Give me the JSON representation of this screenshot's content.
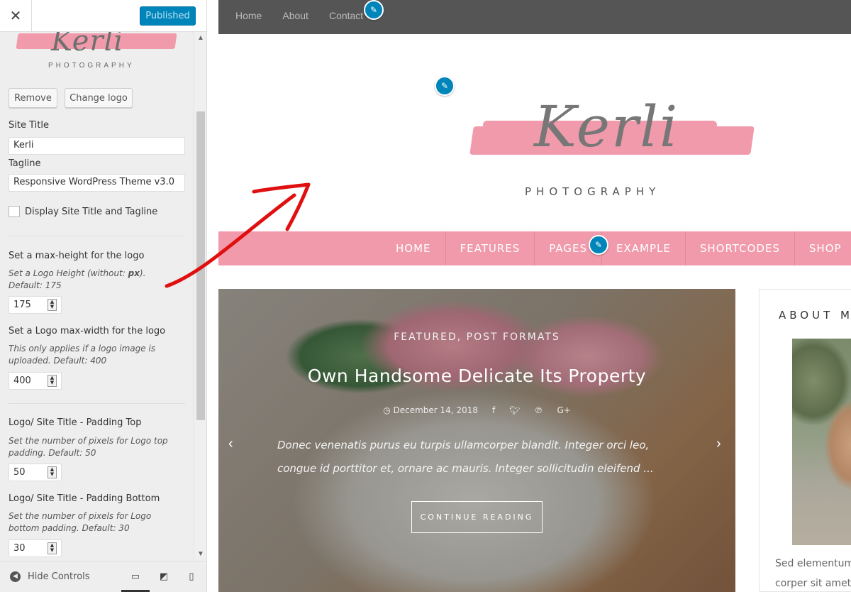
{
  "sidebar": {
    "close_glyph": "✕",
    "publish_label": "Published",
    "logo_preview": {
      "script_text": "Kerli",
      "sub_text": "PHOTOGRAPHY"
    },
    "buttons": {
      "remove": "Remove",
      "change_logo": "Change logo"
    },
    "site_title_label": "Site Title",
    "site_title_value": "Kerli",
    "tagline_label": "Tagline",
    "tagline_value": "Responsive WordPress Theme v3.0",
    "display_title_label": "Display Site Title and Tagline",
    "max_height": {
      "label": "Set a max-height for the logo",
      "desc_1": "Set a Logo Height (without: ",
      "desc_bold": "px",
      "desc_2": "). Default: 175",
      "value": "175"
    },
    "max_width": {
      "label": "Set a Logo max-width for the logo",
      "desc": "This only applies if a logo image is uploaded. Default: 400",
      "value": "400"
    },
    "padding_top": {
      "label": "Logo/ Site Title - Padding Top",
      "desc": "Set the number of pixels for Logo top padding. Default: 50",
      "value": "50"
    },
    "padding_bottom": {
      "label": "Logo/ Site Title - Padding Bottom",
      "desc": "Set the number of pixels for Logo bottom padding. Default: 30",
      "value": "30"
    },
    "footer": {
      "hide_controls": "Hide Controls",
      "active_device": "desktop"
    }
  },
  "preview": {
    "topbar_links": [
      "Home",
      "About",
      "Contact"
    ],
    "logo": {
      "script_text": "Kerli",
      "sub_text": "PHOTOGRAPHY"
    },
    "nav": [
      "HOME",
      "FEATURES",
      "PAGES",
      "EXAMPLE",
      "SHORTCODES",
      "SHOP"
    ],
    "slide": {
      "categories": "FEATURED, POST FORMATS",
      "title": "Own Handsome Delicate Its Property",
      "date": "December 14, 2018",
      "excerpt": "Donec venenatis purus eu turpis ullamcorper blandit. Integer orci leo, congue id porttitor et, ornare ac mauris. Integer sollicitudin eleifend  ...",
      "button": "CONTINUE READING"
    },
    "widget": {
      "title": "ABOUT M",
      "text_line_1": "Sed elementum",
      "text_line_2": "corper sit amet"
    }
  },
  "colors": {
    "accent_blue": "#0085ba",
    "brand_pink": "#f19aab",
    "topbar_gray": "#555555",
    "annotation_red": "#e01010"
  }
}
